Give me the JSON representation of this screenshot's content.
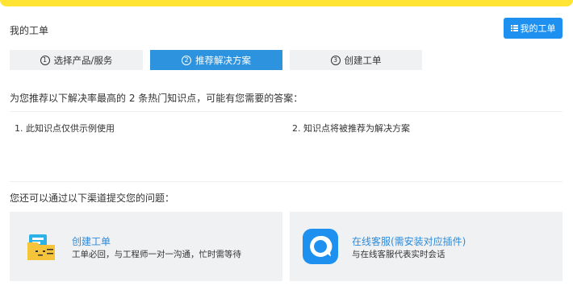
{
  "header": {
    "title": "我的工单",
    "my_tickets_button": "我的工单"
  },
  "steps": [
    {
      "num": "1",
      "label": "选择产品/服务",
      "active": false
    },
    {
      "num": "2",
      "label": "推荐解决方案",
      "active": true
    },
    {
      "num": "3",
      "label": "创建工单",
      "active": false
    }
  ],
  "recommend": {
    "intro": "为您推荐以下解决率最高的 2 条热门知识点，可能有您需要的答案：",
    "items": [
      "1. 此知识点仅供示例使用",
      "2. 知识点将被推荐为解决方案"
    ]
  },
  "channels": {
    "intro": "您还可以通过以下渠道提交您的问题：",
    "cards": [
      {
        "icon": "ticket-folder-icon",
        "title": "创建工单",
        "desc": "工单必回，与工程师一对一沟通，忙时需等待"
      },
      {
        "icon": "chat-bubble-icon",
        "title": "在线客服(需安装对应插件)",
        "desc": "与在线客服代表实时会话"
      }
    ]
  },
  "colors": {
    "topbar": "#ffe433",
    "primary": "#1e90f0",
    "step_active": "#2d93df",
    "link": "#2d8ad8",
    "card_bg": "#f0f1f3"
  }
}
